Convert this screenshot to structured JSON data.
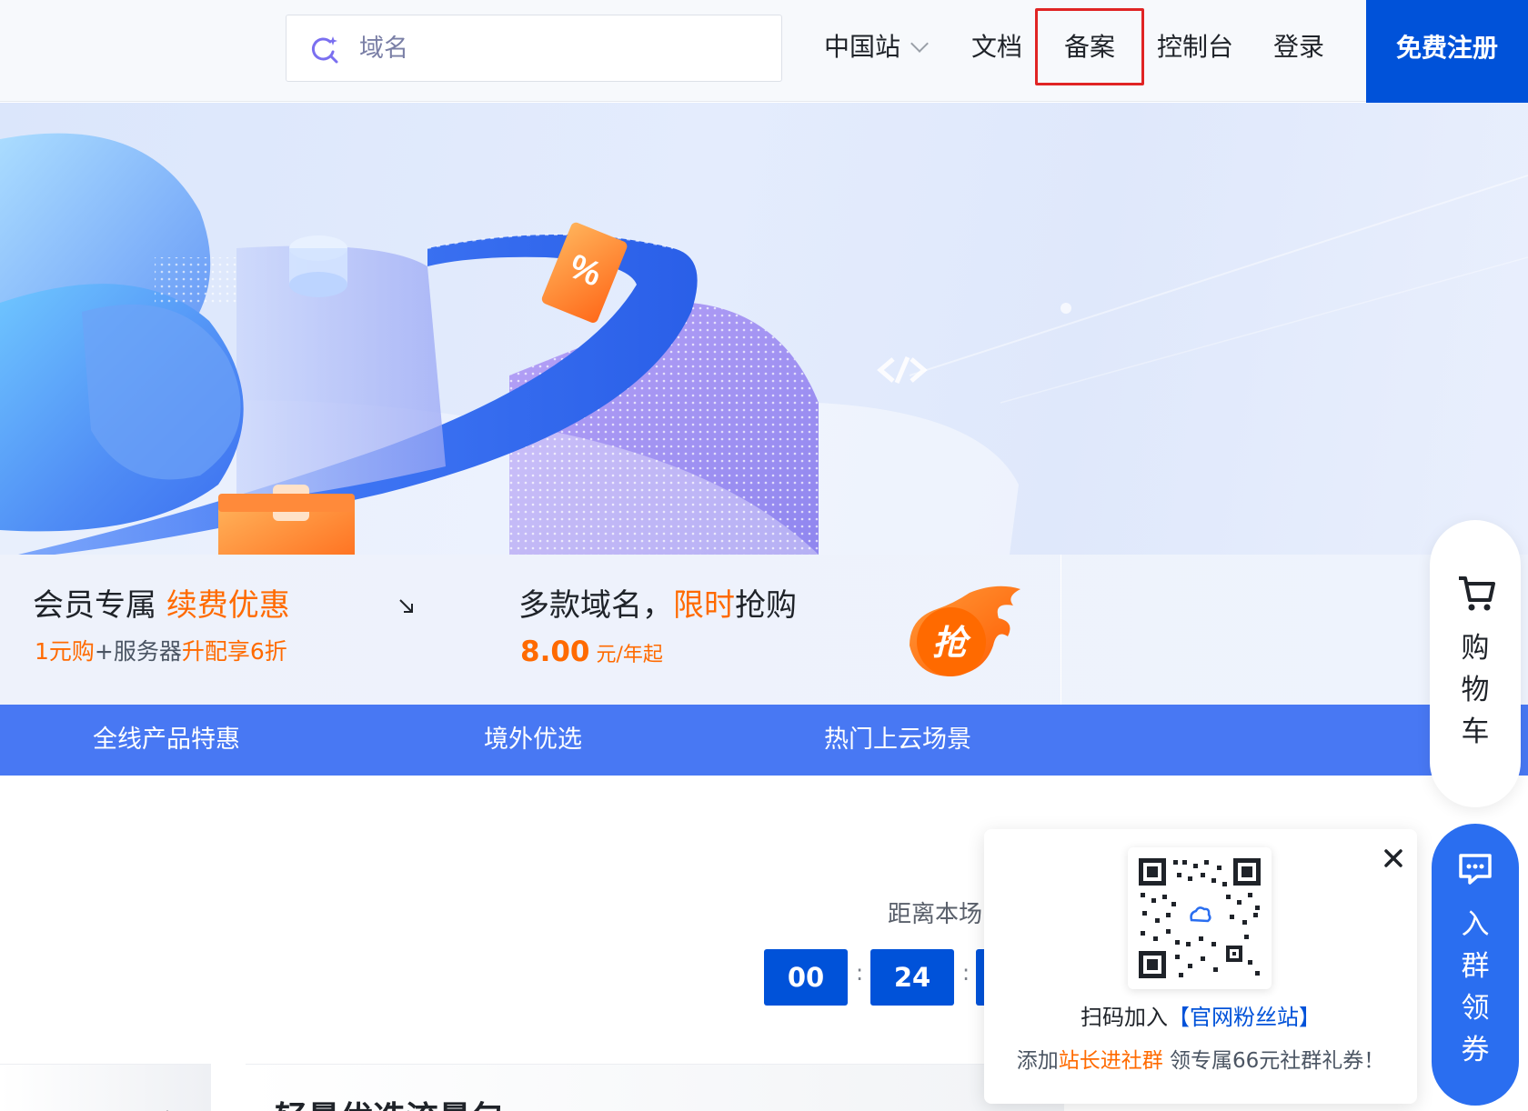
{
  "header": {
    "search_placeholder": "域名",
    "nav": {
      "site": "中国站",
      "docs": "文档",
      "icp": "备案",
      "console": "控制台",
      "login": "登录"
    },
    "register": "免费注册"
  },
  "promo": {
    "left": {
      "title_prefix": "会员专属 ",
      "title_highlight": "续费优惠",
      "sub_1": "1元购",
      "sub_2": "+服务器",
      "sub_3": "升配享6折"
    },
    "right": {
      "title_1": "多款域名，",
      "title_highlight": "限时",
      "title_2": "抢购",
      "price": "8.00",
      "unit": " 元/年起",
      "badge": "抢"
    }
  },
  "tabs": [
    "全线产品特惠",
    "境外优选",
    "热门上云场景"
  ],
  "countdown": {
    "label": "距离本场",
    "hours": "00",
    "minutes": "24",
    "sep": ":"
  },
  "card": {
    "title": "轻量优选流量包"
  },
  "qr_popup": {
    "line1_prefix": "扫码加入",
    "line1_link": "【官网粉丝站】",
    "line2_prefix": "添加",
    "line2_highlight": "站长进社群",
    "line2_suffix": " 领专属66元社群礼券！"
  },
  "float": {
    "cart_chars": [
      "购",
      "物",
      "车"
    ],
    "group_chars": [
      "入",
      "群",
      "领",
      "券"
    ]
  },
  "colors": {
    "brand_blue": "#0052d9",
    "tab_blue": "#4878f3",
    "orange": "#ff6a00",
    "highlight_red": "#e02424"
  }
}
